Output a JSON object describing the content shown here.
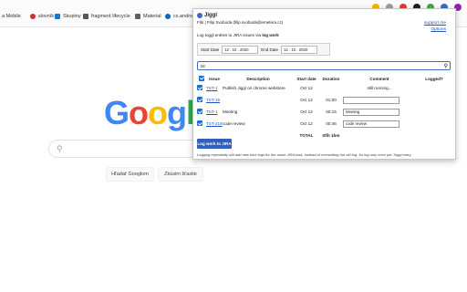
{
  "bookmarks": [
    {
      "label": "a Mobile",
      "color": "#ffffff"
    },
    {
      "label": "slovník",
      "color": "#d32f2f"
    },
    {
      "label": "Skupiny",
      "color": "#1976d2"
    },
    {
      "label": "fragment lifecycle",
      "color": "#555555"
    },
    {
      "label": "Material",
      "color": "#616161"
    },
    {
      "label": "cs.andro",
      "color": "#1565c0"
    }
  ],
  "google": {
    "logo_letters": [
      "G",
      "o",
      "o",
      "g",
      "l",
      "e"
    ],
    "logo_colors": [
      "#4285f4",
      "#ea4335",
      "#fbbc05",
      "#4285f4",
      "#34a853",
      "#ea4335"
    ],
    "search_button": "Hľadať Googlom",
    "lucky_button": "Zkúsim šťastie"
  },
  "popup": {
    "title": "Jiggl",
    "user": "Fibi | Filip Svoboda (filip.svoboda@emetera.cz)",
    "support": "support me",
    "options": "Options",
    "description_prefix": "Log toggl entries to JIRA issues via",
    "description_bold": "log work",
    "start_label": "Start Date",
    "start_value": "12 . 10 . 2020",
    "end_label": "End Date",
    "end_value": "12 . 10 . 2020",
    "filter_value": "tst",
    "headers": [
      "Issue",
      "Description",
      "Start date",
      "Duration",
      "Comment",
      "Logged?"
    ],
    "rows": [
      {
        "issue": "TST-1",
        "description": "Publish Jiggl on chrome webstore",
        "start": "Oct 12",
        "duration": "",
        "comment": "still running...",
        "comment_is_input": false
      },
      {
        "issue": "TST-15",
        "description": "",
        "start": "Oct 12",
        "duration": "01:00",
        "comment": "",
        "comment_is_input": true
      },
      {
        "issue": "TST-1",
        "description": "Meeting",
        "start": "Oct 12",
        "duration": "00:15",
        "comment": "Meeting",
        "comment_is_input": true
      },
      {
        "issue": "TST-219",
        "description": "code review",
        "start": "Oct 12",
        "duration": "00:46",
        "comment": "code review",
        "comment_is_input": true
      }
    ],
    "total_label": "TOTAL",
    "total_value": "0fih 1bm",
    "log_button": "Log work to JIRA",
    "note": "Logging repeatedly will add new time logs for the same JIRA task, instead of overwriting the old log. So log only once per Toggl entry."
  }
}
